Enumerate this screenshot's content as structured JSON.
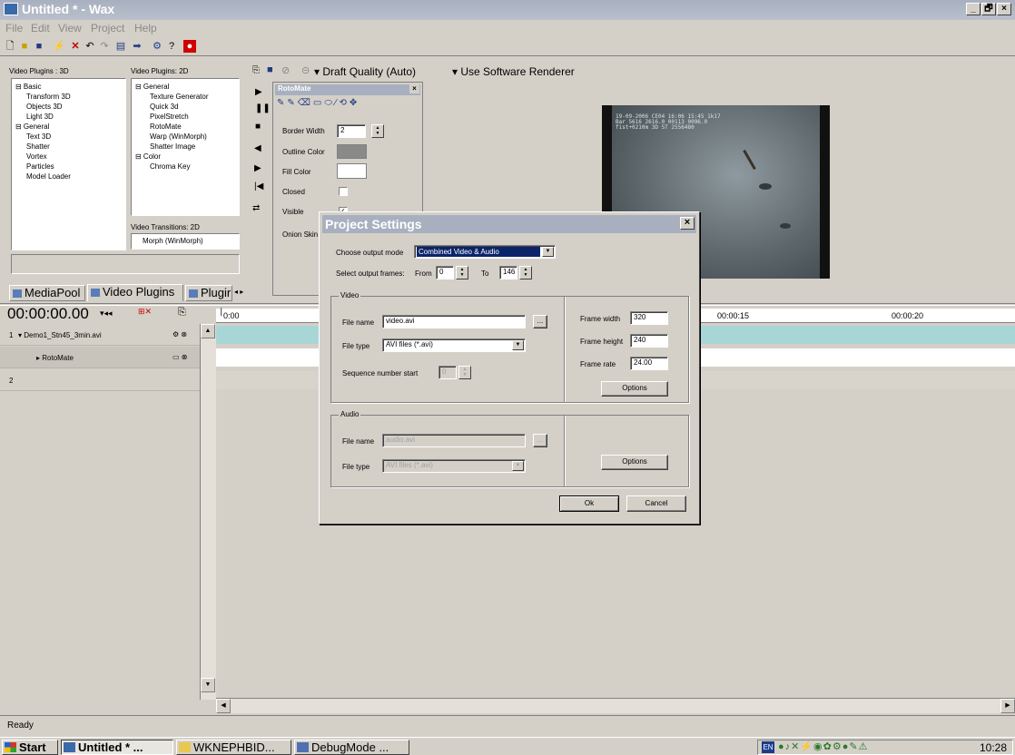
{
  "window": {
    "title": "Untitled * - Wax",
    "min": "_",
    "max": "🗗",
    "close": "×"
  },
  "menu": [
    "File",
    "Edit",
    "View",
    "Project",
    "Help"
  ],
  "plugins_3d": {
    "header": "Video Plugins : 3D",
    "items": [
      "⊟ Basic",
      "Transform 3D",
      "Objects 3D",
      "Light 3D",
      "⊟ General",
      "Text 3D",
      "Shatter",
      "Vortex",
      "Particles",
      "Model Loader"
    ]
  },
  "plugins_2d": {
    "header": "Video Plugins: 2D",
    "items": [
      "⊟ General",
      "Texture Generator",
      "Quick 3d",
      "PixelStretch",
      "RotoMate",
      "Warp (WinMorph)",
      "Shatter Image",
      "⊟ Color",
      "Chroma Key"
    ]
  },
  "transitions_2d": {
    "header": "Video Transitions: 2D",
    "items": [
      "Morph (WinMorph)"
    ]
  },
  "tabs": [
    "MediaPool",
    "Video Plugins",
    "Plugir"
  ],
  "preview_toolbar": {
    "quality": "▾ Draft Quality (Auto)",
    "renderer": "▾ Use Software Renderer"
  },
  "rotomate": {
    "title": "RotoMate",
    "border_width_label": "Border Width",
    "border_width_value": "2",
    "outline_color_label": "Outline Color",
    "fill_color_label": "Fill Color",
    "closed_label": "Closed",
    "visible_label": "Visible",
    "onion_label": "Onion Skin",
    "outline_color": "#8a8a8a",
    "fill_color": "#ffffff"
  },
  "video_overlay": {
    "line1": "19-09-2006 CE04 16:06 15:45 1k17",
    "line2": "Bar 5616 2616.0 00113 0096.0",
    "line3": "fist+0210m 3D 5T 2556480"
  },
  "timeline": {
    "timecode": "00:00:00.00",
    "ruler": [
      "0:00",
      "00:00:15",
      "00:00:20"
    ],
    "tracks": [
      {
        "num": "1",
        "name": "▾ Demo1_Stn45_3min.avi"
      },
      {
        "num": "",
        "name": "▸ RotoMate"
      },
      {
        "num": "2",
        "name": ""
      }
    ]
  },
  "dialog": {
    "title": "Project Settings",
    "output_mode_label": "Choose output mode",
    "output_mode_value": "Combined Video & Audio",
    "frames_label": "Select output frames:",
    "from_label": "From",
    "from_value": "0",
    "to_label": "To",
    "to_value": "146",
    "video_group": "Video",
    "file_name_label": "File name",
    "file_name_value": "video.avi",
    "file_type_label": "File type",
    "file_type_value": "AVI files (*.avi)",
    "seq_label": "Sequence number start",
    "seq_value": "0",
    "frame_width_label": "Frame width",
    "frame_width_value": "320",
    "frame_height_label": "Frame height",
    "frame_height_value": "240",
    "frame_rate_label": "Frame rate",
    "frame_rate_value": "24.00",
    "options_label": "Options",
    "audio_group": "Audio",
    "audio_file_name_value": "audio.avi",
    "audio_file_type_value": "AVI files (*.avi)",
    "browse": "...",
    "ok": "Ok",
    "cancel": "Cancel",
    "close": "×"
  },
  "status": "Ready",
  "taskbar": {
    "start": "Start",
    "tasks": [
      "Untitled * ...",
      "WKNEPHBID...",
      "DebugMode ..."
    ],
    "lang": "EN",
    "time": "10:28"
  }
}
